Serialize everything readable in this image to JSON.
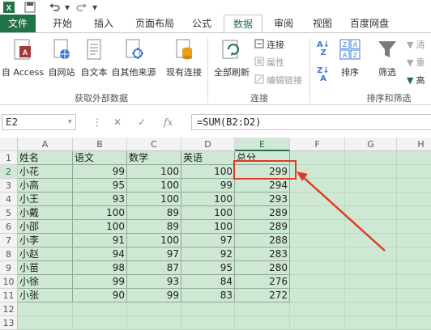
{
  "quick_access": {
    "app_icon": "excel-icon",
    "save_icon": "save-icon",
    "undo_icon": "undo-icon",
    "redo_icon": "redo-icon"
  },
  "tabs": [
    {
      "label": "文件"
    },
    {
      "label": "开始"
    },
    {
      "label": "插入"
    },
    {
      "label": "页面布局"
    },
    {
      "label": "公式"
    },
    {
      "label": "数据"
    },
    {
      "label": "审阅"
    },
    {
      "label": "视图"
    },
    {
      "label": "百度网盘"
    }
  ],
  "active_tab": "数据",
  "ribbon": {
    "get_external": {
      "buttons": [
        {
          "label": "自 Access",
          "icon": "access-icon"
        },
        {
          "label": "自网站",
          "icon": "web-icon"
        },
        {
          "label": "自文本",
          "icon": "text-file-icon"
        },
        {
          "label": "自其他来源",
          "icon": "other-sources-icon"
        },
        {
          "label": "现有连接",
          "icon": "existing-connections-icon"
        }
      ],
      "group_label": "获取外部数据"
    },
    "connections": {
      "refresh_label": "全部刷新",
      "items": [
        {
          "label": "连接",
          "enabled": true
        },
        {
          "label": "属性",
          "enabled": false
        },
        {
          "label": "编辑链接",
          "enabled": false
        }
      ],
      "group_label": "连接"
    },
    "sort_filter": {
      "sort_label": "排序",
      "filter_label": "筛选",
      "right_items": [
        "清",
        "重",
        "高"
      ],
      "group_label": "排序和筛选"
    }
  },
  "formula_bar": {
    "name_box": "E2",
    "formula": "=SUM(B2:D2)"
  },
  "sheet": {
    "columns": [
      "A",
      "B",
      "C",
      "D",
      "E",
      "F",
      "G",
      "H"
    ],
    "selected_column": "E",
    "row_numbers": [
      "1",
      "2",
      "3",
      "4",
      "5",
      "6",
      "7",
      "8",
      "9",
      "10",
      "11",
      "12",
      "13"
    ],
    "selected_row": "2",
    "header_row": [
      "姓名",
      "语文",
      "数学",
      "英语",
      "总分"
    ],
    "rows": [
      [
        "小花",
        "99",
        "100",
        "100",
        "299"
      ],
      [
        "小高",
        "95",
        "100",
        "99",
        "294"
      ],
      [
        "小王",
        "93",
        "100",
        "100",
        "293"
      ],
      [
        "小戴",
        "100",
        "89",
        "100",
        "289"
      ],
      [
        "小邵",
        "100",
        "89",
        "100",
        "289"
      ],
      [
        "小李",
        "91",
        "100",
        "97",
        "288"
      ],
      [
        "小赵",
        "94",
        "97",
        "92",
        "283"
      ],
      [
        "小苗",
        "98",
        "87",
        "95",
        "280"
      ],
      [
        "小徐",
        "99",
        "93",
        "84",
        "276"
      ],
      [
        "小张",
        "90",
        "99",
        "83",
        "272"
      ]
    ]
  },
  "colors": {
    "accent": "#217346",
    "cell_fill": "#cfe8d3",
    "annotation": "#e03b24"
  }
}
